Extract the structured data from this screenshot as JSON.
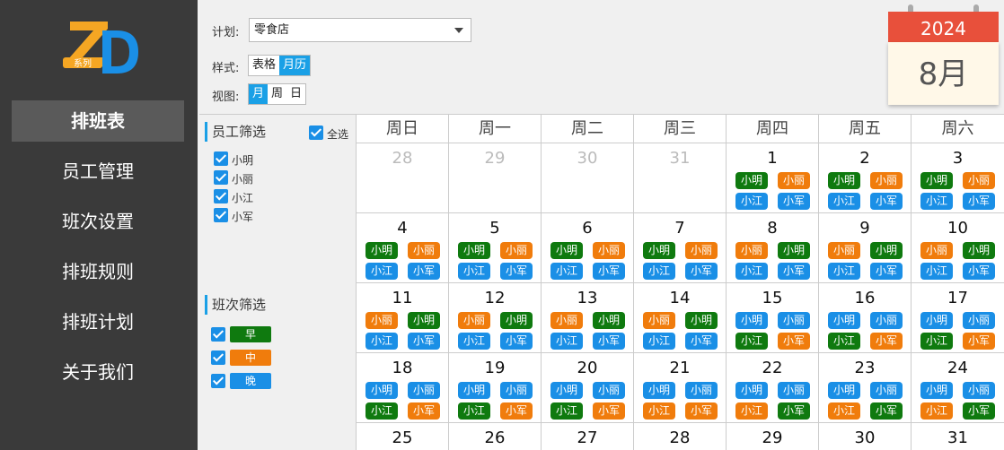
{
  "sidebar": {
    "logo": {
      "letters": "ZD",
      "tag": "系列"
    },
    "items": [
      {
        "label": "排班表",
        "active": true
      },
      {
        "label": "员工管理",
        "active": false
      },
      {
        "label": "班次设置",
        "active": false
      },
      {
        "label": "排班规则",
        "active": false
      },
      {
        "label": "排班计划",
        "active": false
      },
      {
        "label": "关于我们",
        "active": false
      }
    ]
  },
  "controls": {
    "plan_label": "计划:",
    "plan_value": "零食店",
    "style_label": "样式:",
    "style_options": [
      "表格",
      "月历"
    ],
    "style_selected": "月历",
    "view_label": "视图:",
    "view_options": [
      "月",
      "周",
      "日"
    ],
    "view_selected": "月"
  },
  "date_widget": {
    "year": "2024",
    "month": "8月"
  },
  "filters": {
    "staff_title": "员工筛选",
    "select_all": "全选",
    "staff": [
      "小明",
      "小丽",
      "小江",
      "小军"
    ],
    "shift_title": "班次筛选",
    "shifts": [
      {
        "label": "早",
        "color": "#0f7a0f"
      },
      {
        "label": "中",
        "color": "#f07c0c"
      },
      {
        "label": "晚",
        "color": "#1a8fe6"
      }
    ]
  },
  "colors": {
    "early": "#0f7a0f",
    "mid": "#f07c0c",
    "late": "#1a8fe6",
    "accent": "#1aa0e6"
  },
  "calendar": {
    "weekdays": [
      "周日",
      "周一",
      "周二",
      "周三",
      "周四",
      "周五",
      "周六"
    ],
    "weeks": [
      [
        {
          "day": "28",
          "other": true,
          "chips": []
        },
        {
          "day": "29",
          "other": true,
          "chips": []
        },
        {
          "day": "30",
          "other": true,
          "chips": []
        },
        {
          "day": "31",
          "other": true,
          "chips": []
        },
        {
          "day": "1",
          "chips": [
            [
              "小明",
              "early"
            ],
            [
              "小丽",
              "mid"
            ],
            [
              "小江",
              "late"
            ],
            [
              "小军",
              "late"
            ]
          ]
        },
        {
          "day": "2",
          "chips": [
            [
              "小明",
              "early"
            ],
            [
              "小丽",
              "mid"
            ],
            [
              "小江",
              "late"
            ],
            [
              "小军",
              "late"
            ]
          ]
        },
        {
          "day": "3",
          "chips": [
            [
              "小明",
              "early"
            ],
            [
              "小丽",
              "mid"
            ],
            [
              "小江",
              "late"
            ],
            [
              "小军",
              "late"
            ]
          ]
        }
      ],
      [
        {
          "day": "4",
          "chips": [
            [
              "小明",
              "early"
            ],
            [
              "小丽",
              "mid"
            ],
            [
              "小江",
              "late"
            ],
            [
              "小军",
              "late"
            ]
          ]
        },
        {
          "day": "5",
          "chips": [
            [
              "小明",
              "early"
            ],
            [
              "小丽",
              "mid"
            ],
            [
              "小江",
              "late"
            ],
            [
              "小军",
              "late"
            ]
          ]
        },
        {
          "day": "6",
          "chips": [
            [
              "小明",
              "early"
            ],
            [
              "小丽",
              "mid"
            ],
            [
              "小江",
              "late"
            ],
            [
              "小军",
              "late"
            ]
          ]
        },
        {
          "day": "7",
          "chips": [
            [
              "小明",
              "early"
            ],
            [
              "小丽",
              "mid"
            ],
            [
              "小江",
              "late"
            ],
            [
              "小军",
              "late"
            ]
          ]
        },
        {
          "day": "8",
          "chips": [
            [
              "小丽",
              "mid"
            ],
            [
              "小明",
              "early"
            ],
            [
              "小江",
              "late"
            ],
            [
              "小军",
              "late"
            ]
          ]
        },
        {
          "day": "9",
          "chips": [
            [
              "小丽",
              "mid"
            ],
            [
              "小明",
              "early"
            ],
            [
              "小江",
              "late"
            ],
            [
              "小军",
              "late"
            ]
          ]
        },
        {
          "day": "10",
          "chips": [
            [
              "小丽",
              "mid"
            ],
            [
              "小明",
              "early"
            ],
            [
              "小江",
              "late"
            ],
            [
              "小军",
              "late"
            ]
          ]
        }
      ],
      [
        {
          "day": "11",
          "chips": [
            [
              "小丽",
              "mid"
            ],
            [
              "小明",
              "early"
            ],
            [
              "小江",
              "late"
            ],
            [
              "小军",
              "late"
            ]
          ]
        },
        {
          "day": "12",
          "chips": [
            [
              "小丽",
              "mid"
            ],
            [
              "小明",
              "early"
            ],
            [
              "小江",
              "late"
            ],
            [
              "小军",
              "late"
            ]
          ]
        },
        {
          "day": "13",
          "chips": [
            [
              "小丽",
              "mid"
            ],
            [
              "小明",
              "early"
            ],
            [
              "小江",
              "late"
            ],
            [
              "小军",
              "late"
            ]
          ]
        },
        {
          "day": "14",
          "chips": [
            [
              "小丽",
              "mid"
            ],
            [
              "小明",
              "early"
            ],
            [
              "小江",
              "late"
            ],
            [
              "小军",
              "late"
            ]
          ]
        },
        {
          "day": "15",
          "chips": [
            [
              "小明",
              "late"
            ],
            [
              "小丽",
              "late"
            ],
            [
              "小江",
              "early"
            ],
            [
              "小军",
              "mid"
            ]
          ]
        },
        {
          "day": "16",
          "chips": [
            [
              "小明",
              "late"
            ],
            [
              "小丽",
              "late"
            ],
            [
              "小江",
              "early"
            ],
            [
              "小军",
              "mid"
            ]
          ]
        },
        {
          "day": "17",
          "chips": [
            [
              "小明",
              "late"
            ],
            [
              "小丽",
              "late"
            ],
            [
              "小江",
              "early"
            ],
            [
              "小军",
              "mid"
            ]
          ]
        }
      ],
      [
        {
          "day": "18",
          "chips": [
            [
              "小明",
              "late"
            ],
            [
              "小丽",
              "late"
            ],
            [
              "小江",
              "early"
            ],
            [
              "小军",
              "mid"
            ]
          ]
        },
        {
          "day": "19",
          "chips": [
            [
              "小明",
              "late"
            ],
            [
              "小丽",
              "late"
            ],
            [
              "小江",
              "early"
            ],
            [
              "小军",
              "mid"
            ]
          ]
        },
        {
          "day": "20",
          "chips": [
            [
              "小明",
              "late"
            ],
            [
              "小丽",
              "late"
            ],
            [
              "小江",
              "early"
            ],
            [
              "小军",
              "mid"
            ]
          ]
        },
        {
          "day": "21",
          "chips": [
            [
              "小明",
              "late"
            ],
            [
              "小丽",
              "late"
            ],
            [
              "小江",
              "mid"
            ],
            [
              "小军",
              "mid"
            ]
          ]
        },
        {
          "day": "22",
          "chips": [
            [
              "小明",
              "late"
            ],
            [
              "小丽",
              "late"
            ],
            [
              "小江",
              "mid"
            ],
            [
              "小军",
              "early"
            ]
          ]
        },
        {
          "day": "23",
          "chips": [
            [
              "小明",
              "late"
            ],
            [
              "小丽",
              "late"
            ],
            [
              "小江",
              "mid"
            ],
            [
              "小军",
              "early"
            ]
          ]
        },
        {
          "day": "24",
          "chips": [
            [
              "小明",
              "late"
            ],
            [
              "小丽",
              "late"
            ],
            [
              "小江",
              "mid"
            ],
            [
              "小军",
              "early"
            ]
          ]
        }
      ],
      [
        {
          "day": "25",
          "chips": []
        },
        {
          "day": "26",
          "chips": []
        },
        {
          "day": "27",
          "chips": []
        },
        {
          "day": "28",
          "chips": []
        },
        {
          "day": "29",
          "chips": []
        },
        {
          "day": "30",
          "chips": []
        },
        {
          "day": "31",
          "chips": []
        }
      ]
    ]
  }
}
